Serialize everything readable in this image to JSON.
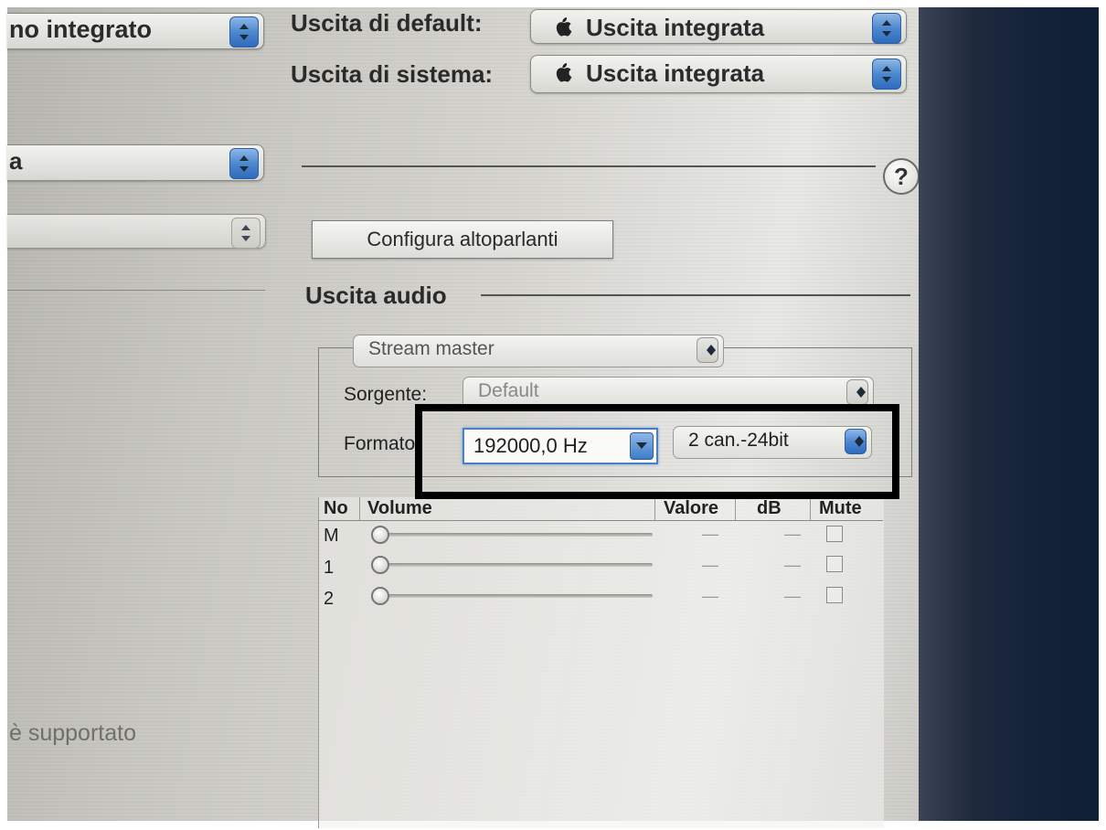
{
  "left_panel": {
    "top_popup": "no integrato",
    "mid_popup": "a",
    "bottom_text": "è supportato"
  },
  "outputs": {
    "default_label": "Uscita di default:",
    "default_value": "Uscita integrata",
    "system_label": "Uscita di sistema:",
    "system_value": "Uscita integrata"
  },
  "help_label": "?",
  "configure_button": "Configura altoparlanti",
  "audio_output": {
    "title": "Uscita audio",
    "stream_popup": "Stream master",
    "source_label": "Sorgente:",
    "source_value": "Default",
    "format_label": "Formato:",
    "format_rate": "192000,0 Hz",
    "format_channels": "2 can.-24bit"
  },
  "table": {
    "headers": [
      "No",
      "Volume",
      "Valore",
      "dB",
      "Mute"
    ],
    "rows": [
      {
        "no": "M",
        "value": "—",
        "db": "—"
      },
      {
        "no": "1",
        "value": "—",
        "db": "—"
      },
      {
        "no": "2",
        "value": "—",
        "db": "—"
      }
    ]
  },
  "colors": {
    "accent": "#3e7cc9",
    "highlight_frame": "#000000"
  }
}
